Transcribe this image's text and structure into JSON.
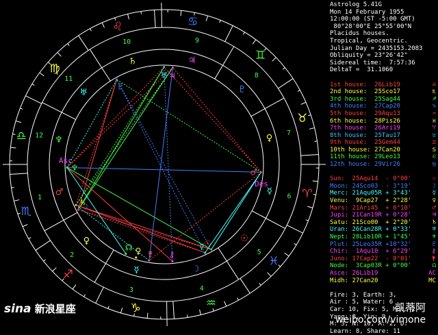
{
  "header": {
    "lines": [
      "Astrolog 5.41G",
      "Mon 14 February 1955",
      "12:00:00 (ST -5:00 GMT)",
      " 80°28'00\"E 25°55'00\"N",
      "Placidus houses.",
      "Tropical, Geocentric.",
      "Julian Day = 2435153.2083",
      "Obliquity = 23°26'42\"",
      "Sidereal time:  7:57:36",
      "DeltaT =  31.1060"
    ]
  },
  "houses": [
    {
      "label": "1st house:",
      "value": "26Lib19",
      "color": "#ff4040",
      "sym": "♎"
    },
    {
      "label": "2nd house:",
      "value": "25Sco17",
      "color": "#ffff40",
      "sym": "♏"
    },
    {
      "label": "3rd house:",
      "value": "25Sag44",
      "color": "#40ff40",
      "sym": "♐"
    },
    {
      "label": "4th house:",
      "value": "27Cap20",
      "color": "#4080ff",
      "sym": "♑"
    },
    {
      "label": "5th house:",
      "value": "29Aqu13",
      "color": "#ff4040",
      "sym": "♒"
    },
    {
      "label": "6th house:",
      "value": "28Pis26",
      "color": "#ffff40",
      "sym": "♓"
    },
    {
      "label": "7th house:",
      "value": "26Ari19",
      "color": "#ff40ff",
      "sym": "♈"
    },
    {
      "label": "8th house:",
      "value": "25Tau17",
      "color": "#40c0ff",
      "sym": "♉"
    },
    {
      "label": "9th house:",
      "value": "25Gem44",
      "color": "#ff4040",
      "sym": "♊"
    },
    {
      "label": "10th house:",
      "value": "27Can20",
      "color": "#ffff40",
      "sym": "♋"
    },
    {
      "label": "11th house:",
      "value": "29Leo13",
      "color": "#40ff40",
      "sym": "♌"
    },
    {
      "label": "12th house:",
      "value": "29Vir26",
      "color": "#4080ff",
      "sym": "♍"
    }
  ],
  "planets": [
    {
      "label": "Sun:",
      "value": "25Aqu14  - 0°00'",
      "color": "#ff4040",
      "sym": "☉"
    },
    {
      "label": "Moon:",
      "value": "24Sco03  - 3°19'",
      "color": "#4080ff",
      "sym": "☽"
    },
    {
      "label": "Merc:",
      "value": "21Aqu05R + 3°43'",
      "color": "#40ffff",
      "sym": "☿"
    },
    {
      "label": "Venu:",
      "value": " 9Cap27  + 2°28'",
      "color": "#ffff40",
      "sym": "♀"
    },
    {
      "label": "Mars:",
      "value": "21Ari45  + 0°10'",
      "color": "#ff4040",
      "sym": "♂"
    },
    {
      "label": "Jupi:",
      "value": "21Can19R + 0°28'",
      "color": "#ff40ff",
      "sym": "♃"
    },
    {
      "label": "Satu:",
      "value": "21Sco00  + 2°20'",
      "color": "#ffff40",
      "sym": "♄"
    },
    {
      "label": "Uran:",
      "value": "26Can28R + 0°33'",
      "color": "#40ffff",
      "sym": "♅"
    },
    {
      "label": "Nept:",
      "value": "28Lib10R + 1°45'",
      "color": "#40ff40",
      "sym": "♆"
    },
    {
      "label": "Plut:",
      "value": "25Leo35R +10°32'",
      "color": "#4080ff",
      "sym": "♇"
    },
    {
      "label": "Chir:",
      "value": " 1Aqu10  + 6°29'",
      "color": "#ff40ff",
      "sym": "⚷"
    },
    {
      "label": "Juno:",
      "value": "17Cap22  - 0°01'",
      "color": "#ff4040",
      "sym": "⚵"
    },
    {
      "label": "Node:",
      "value": " 3Cap03R + 0°00'",
      "color": "#40ff40",
      "sym": "☊"
    },
    {
      "label": "Asce:",
      "value": "26Lib19",
      "color": "#ff40ff",
      "sym": "AC"
    },
    {
      "label": "Midh:",
      "value": "27Can20",
      "color": "#ffff40",
      "sym": "MC"
    }
  ],
  "summary": [
    "Fire: 3, Earth: 3,",
    "Air : 5, Water: 6",
    "Car: 10, Fix: 5, Mut: 2",
    "Yang: 8, Yin: 9",
    "M: 3, N: 10, A: 2, D:",
    "Learn: 8, Share: 11"
  ],
  "wheel": {
    "asc_label": "Asc",
    "des_label": "Des",
    "houses_num": [
      "1",
      "2",
      "3",
      "4",
      "5",
      "6",
      "7",
      "8",
      "9",
      "10",
      "11",
      "12"
    ],
    "signs": [
      "♈",
      "♉",
      "♊",
      "♋",
      "♌",
      "♍",
      "♎",
      "♏",
      "♐",
      "♑",
      "♒",
      "♓"
    ],
    "sign_colors": [
      "#ff4040",
      "#ffff40",
      "#40ff40",
      "#4080ff",
      "#ff4040",
      "#ffff40",
      "#40ff40",
      "#4080ff",
      "#ff4040",
      "#ffff40",
      "#40ff40",
      "#4080ff"
    ],
    "ruler_glyphs": [
      "♂",
      "♀",
      "☿",
      "☽",
      "☉",
      "☿",
      "♀",
      "♇",
      "♃",
      "♄",
      "♅",
      "♆"
    ],
    "ruler_colors": [
      "#ff4040",
      "#ffff40",
      "#40ffff",
      "#4080ff",
      "#ff4040",
      "#40ffff",
      "#ffff40",
      "#4080ff",
      "#ff40ff",
      "#ffff40",
      "#40ffff",
      "#40ff40"
    ]
  },
  "watermarks": {
    "sina_brand": "sina",
    "sina_text": "新浪星座",
    "weibo_name": "凯蒂阿",
    "weibo_url": "weibo.com/vimone"
  }
}
